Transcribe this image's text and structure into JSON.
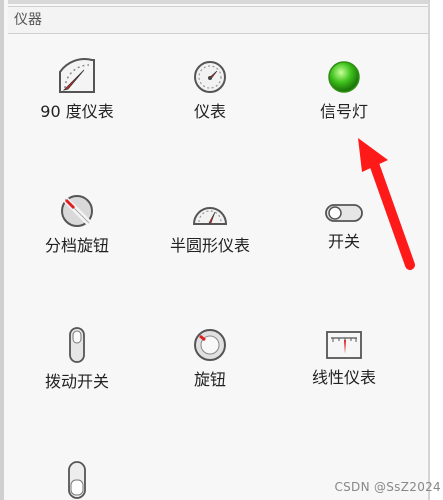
{
  "panel": {
    "section_title": "仪器",
    "items": [
      {
        "label": "90 度仪表",
        "icon": "quarter-gauge-icon"
      },
      {
        "label": "仪表",
        "icon": "dial-gauge-icon"
      },
      {
        "label": "信号灯",
        "icon": "signal-light-icon"
      },
      {
        "label": "分档旋钮",
        "icon": "step-knob-icon"
      },
      {
        "label": "半圆形仪表",
        "icon": "semicircle-gauge-icon"
      },
      {
        "label": "开关",
        "icon": "toggle-switch-icon"
      },
      {
        "label": "拨动开关",
        "icon": "slide-toggle-icon"
      },
      {
        "label": "旋钮",
        "icon": "rotary-knob-icon"
      },
      {
        "label": "线性仪表",
        "icon": "linear-gauge-icon"
      },
      {
        "label": "",
        "icon": "vertical-switch-icon"
      }
    ]
  },
  "annotation": {
    "arrow_color": "#ff1a1a"
  },
  "watermark": "CSDN @SsZ2024",
  "colors": {
    "signal_green": "#3fc21c",
    "needle_red": "#e02020"
  }
}
